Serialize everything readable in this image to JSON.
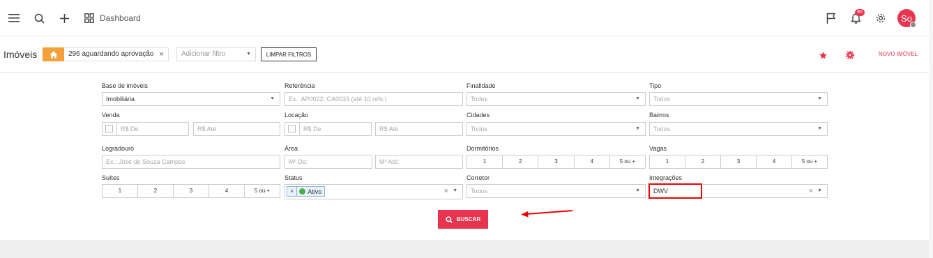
{
  "topbar": {
    "dashboard_label": "Dashboard",
    "notification_count": "90",
    "avatar_initials": "So"
  },
  "filterbar": {
    "title": "Imóveis",
    "chip_label": "296 aguardando aprovação",
    "add_filter_placeholder": "Adicionar filtro",
    "clear_button": "LIMPAR FILTROS",
    "new_property": "NOVO IMÓVEL"
  },
  "form": {
    "base_label": "Base de imóveis",
    "base_value": "Imobiliária",
    "referencia_label": "Referência",
    "referencia_placeholder": "Ex.: AP0022, CA0033 (até 10 refs.)",
    "finalidade_label": "Finalidade",
    "finalidade_value": "Todos",
    "tipo_label": "Tipo",
    "tipo_value": "Todos",
    "venda_label": "Venda",
    "venda_de": "R$ De",
    "venda_ate": "R$ Até",
    "locacao_label": "Locação",
    "locacao_de": "R$ De",
    "locacao_ate": "R$ Até",
    "cidades_label": "Cidades",
    "cidades_value": "Todos",
    "bairros_label": "Bairros",
    "bairros_value": "Todos",
    "logradouro_label": "Logradouro",
    "logradouro_placeholder": "Ex.: José de Souza Campos",
    "area_label": "Área",
    "area_de": "M² De:",
    "area_ate": "M² Até:",
    "dormitorios_label": "Dormitórios",
    "vagas_label": "Vagas",
    "suites_label": "Suítes",
    "status_label": "Status",
    "status_tag": "Ativo",
    "corretor_label": "Corretor",
    "corretor_value": "Todos",
    "integracoes_label": "Integrações",
    "integracoes_value": "DWV",
    "counts": [
      "1",
      "2",
      "3",
      "4",
      "5 ou +"
    ],
    "search_button": "BUSCAR"
  },
  "colors": {
    "accent": "#e8344e",
    "home_chip": "#f4a13c",
    "highlight": "#ee0000"
  }
}
